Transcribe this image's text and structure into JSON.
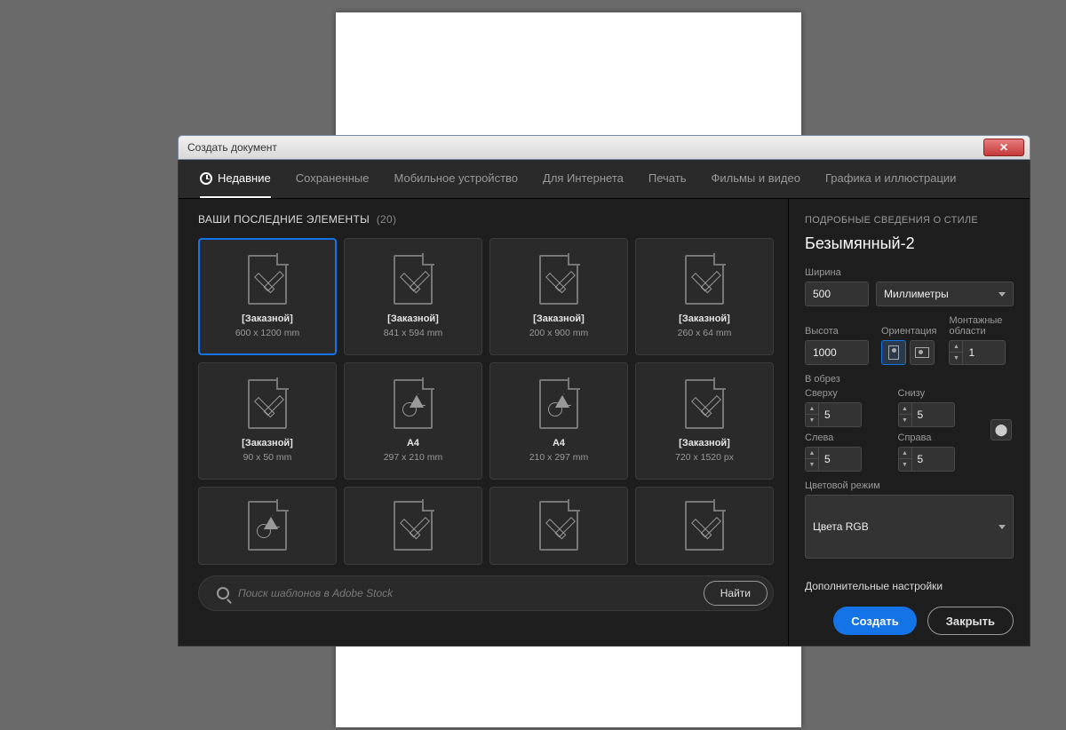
{
  "window_title": "Создать документ",
  "tabs": [
    {
      "label": "Недавние",
      "active": true
    },
    {
      "label": "Сохраненные"
    },
    {
      "label": "Мобильное устройство"
    },
    {
      "label": "Для Интернета"
    },
    {
      "label": "Печать"
    },
    {
      "label": "Фильмы и видео"
    },
    {
      "label": "Графика и иллюстрации"
    }
  ],
  "section_title": "ВАШИ ПОСЛЕДНИЕ ЭЛЕМЕНТЫ",
  "section_count": "(20)",
  "presets": [
    {
      "name": "[Заказной]",
      "dim": "600 x 1200 mm",
      "icon": "pencil",
      "selected": true
    },
    {
      "name": "[Заказной]",
      "dim": "841 x 594 mm",
      "icon": "pencil"
    },
    {
      "name": "[Заказной]",
      "dim": "200 x 900 mm",
      "icon": "pencil"
    },
    {
      "name": "[Заказной]",
      "dim": "260 x 64 mm",
      "icon": "pencil"
    },
    {
      "name": "[Заказной]",
      "dim": "90 x 50 mm",
      "icon": "pencil"
    },
    {
      "name": "A4",
      "dim": "297 x 210 mm",
      "icon": "shapes"
    },
    {
      "name": "A4",
      "dim": "210 x 297 mm",
      "icon": "shapes"
    },
    {
      "name": "[Заказной]",
      "dim": "720 x 1520 px",
      "icon": "pencil"
    },
    {
      "name": "",
      "dim": "",
      "icon": "shapes",
      "short": true
    },
    {
      "name": "",
      "dim": "",
      "icon": "pencil",
      "short": true
    },
    {
      "name": "",
      "dim": "",
      "icon": "pencil",
      "short": true
    },
    {
      "name": "",
      "dim": "",
      "icon": "pencil",
      "short": true
    }
  ],
  "search": {
    "placeholder": "Поиск шаблонов в Adobe Stock",
    "go": "Найти"
  },
  "details": {
    "heading": "ПОДРОБНЫЕ СВЕДЕНИЯ О СТИЛЕ",
    "docname": "Безымянный-2",
    "width_label": "Ширина",
    "width": "500",
    "units": "Миллиметры",
    "height_label": "Высота",
    "height": "1000",
    "orientation_label": "Ориентация",
    "artboards_label": "Монтажные области",
    "artboards": "1",
    "bleed_label": "В обрез",
    "top_label": "Сверху",
    "top": "5",
    "bottom_label": "Снизу",
    "bottom": "5",
    "left_label": "Слева",
    "left": "5",
    "right_label": "Справа",
    "right": "5",
    "color_mode_label": "Цветовой режим",
    "color_mode": "Цвета RGB",
    "more": "Дополнительные настройки"
  },
  "buttons": {
    "create": "Создать",
    "close": "Закрыть"
  }
}
